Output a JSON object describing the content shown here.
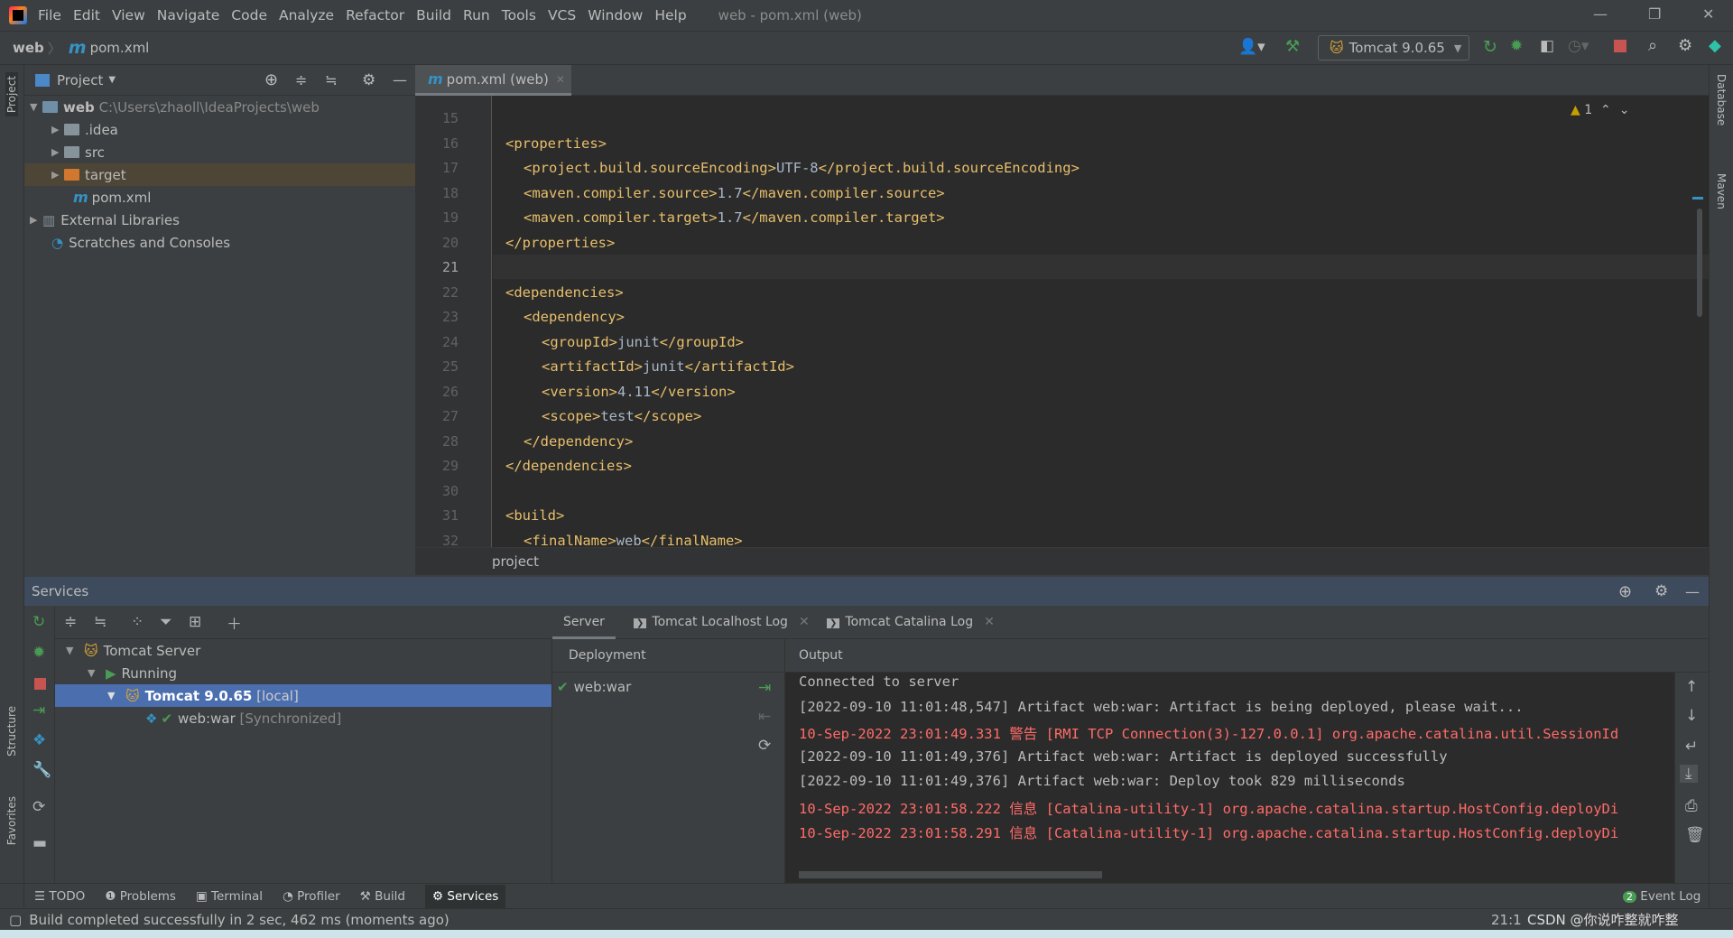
{
  "title_bar": {
    "menu": [
      "File",
      "Edit",
      "View",
      "Navigate",
      "Code",
      "Analyze",
      "Refactor",
      "Build",
      "Run",
      "Tools",
      "VCS",
      "Window",
      "Help"
    ],
    "window_title": "web - pom.xml (web)"
  },
  "nav_bar": {
    "project": "web",
    "file": "pom.xml"
  },
  "toolbar": {
    "run_config": "Tomcat 9.0.65"
  },
  "project_panel": {
    "title": "Project",
    "tree": [
      {
        "label": "web",
        "path": "C:\\Users\\zhaoll\\IdeaProjects\\web",
        "level": 0,
        "expanded": true
      },
      {
        "label": ".idea",
        "level": 1
      },
      {
        "label": "src",
        "level": 1
      },
      {
        "label": "target",
        "level": 1,
        "highlighted": true
      },
      {
        "label": "pom.xml",
        "level": 1
      },
      {
        "label": "External Libraries",
        "level": 0
      },
      {
        "label": "Scratches and Consoles",
        "level": 0
      }
    ]
  },
  "side_stripes": {
    "left": [
      "Project",
      "Structure",
      "Favorites"
    ],
    "right": [
      "Database",
      "Maven"
    ]
  },
  "editor": {
    "tab": "pom.xml (web)",
    "warnings": "1",
    "current_line": 21,
    "breadcrumb": "project",
    "lines": [
      {
        "n": "15",
        "code": ""
      },
      {
        "n": "16",
        "code": "<properties>",
        "indent": 0
      },
      {
        "n": "17",
        "code": "<project.build.sourceEncoding>",
        "val": "UTF-8",
        "end": "</project.build.sourceEncoding>",
        "indent": 1
      },
      {
        "n": "18",
        "code": "<maven.compiler.source>",
        "val": "1.7",
        "end": "</maven.compiler.source>",
        "indent": 1
      },
      {
        "n": "19",
        "code": "<maven.compiler.target>",
        "val": "1.7",
        "end": "</maven.compiler.target>",
        "indent": 1
      },
      {
        "n": "20",
        "code": "</properties>",
        "indent": 0
      },
      {
        "n": "21",
        "code": ""
      },
      {
        "n": "22",
        "code": "<dependencies>",
        "indent": 0
      },
      {
        "n": "23",
        "code": "<dependency>",
        "indent": 1
      },
      {
        "n": "24",
        "code": "<groupId>",
        "val": "junit",
        "end": "</groupId>",
        "indent": 2
      },
      {
        "n": "25",
        "code": "<artifactId>",
        "val": "junit",
        "end": "</artifactId>",
        "indent": 2
      },
      {
        "n": "26",
        "code": "<version>",
        "val": "4.11",
        "end": "</version>",
        "indent": 2
      },
      {
        "n": "27",
        "code": "<scope>",
        "val": "test",
        "end": "</scope>",
        "indent": 2
      },
      {
        "n": "28",
        "code": "</dependency>",
        "indent": 1
      },
      {
        "n": "29",
        "code": "</dependencies>",
        "indent": 0
      },
      {
        "n": "30",
        "code": ""
      },
      {
        "n": "31",
        "code": "<build>",
        "indent": 0
      },
      {
        "n": "32",
        "code": "<finalName>",
        "val": "web",
        "end": "</finalName>",
        "indent": 1
      }
    ]
  },
  "services": {
    "title": "Services",
    "tree": {
      "server": "Tomcat Server",
      "running": "Running",
      "instance": "Tomcat 9.0.65",
      "instance_suffix": "[local]",
      "artifact": "web:war",
      "artifact_suffix": "[Synchronized]"
    },
    "tabs": [
      "Server",
      "Tomcat Localhost Log",
      "Tomcat Catalina Log"
    ],
    "deployment_header": "Deployment",
    "deployment_item": "web:war",
    "output_header": "Output",
    "output": [
      {
        "text": "Connected to server",
        "level": "info"
      },
      {
        "text": "[2022-09-10 11:01:48,547] Artifact web:war: Artifact is being deployed, please wait...",
        "level": "info"
      },
      {
        "text": "10-Sep-2022 23:01:49.331 警告 [RMI TCP Connection(3)-127.0.0.1] org.apache.catalina.util.SessionId",
        "level": "error"
      },
      {
        "text": "[2022-09-10 11:01:49,376] Artifact web:war: Artifact is deployed successfully",
        "level": "info"
      },
      {
        "text": "[2022-09-10 11:01:49,376] Artifact web:war: Deploy took 829 milliseconds",
        "level": "info"
      },
      {
        "text": "10-Sep-2022 23:01:58.222 信息 [Catalina-utility-1] org.apache.catalina.startup.HostConfig.deployDi",
        "level": "error"
      },
      {
        "text": "10-Sep-2022 23:01:58.291 信息 [Catalina-utility-1] org.apache.catalina.startup.HostConfig.deployDi",
        "level": "error"
      }
    ]
  },
  "bottom_tools": [
    "TODO",
    "Problems",
    "Terminal",
    "Profiler",
    "Build",
    "Services"
  ],
  "event_log": {
    "label": "Event Log",
    "count": "2"
  },
  "status_bar": {
    "message": "Build completed successfully in 2 sec, 462 ms (moments ago)",
    "position": "21:1",
    "watermark": "CSDN @你说咋整就咋整"
  }
}
